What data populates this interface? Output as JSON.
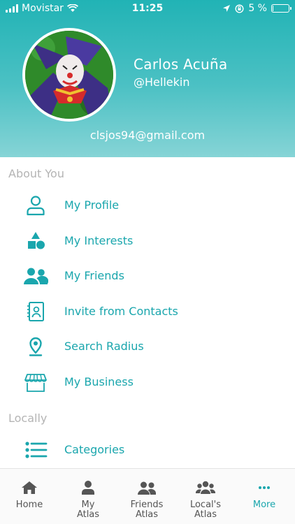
{
  "status_bar": {
    "carrier": "Movistar",
    "time": "11:25",
    "battery_text": "5 %",
    "battery_level": 0.05
  },
  "profile": {
    "name": "Carlos Acuña",
    "handle": "@Hellekin",
    "email": "clsjos94@gmail.com"
  },
  "sections": {
    "about": "About You",
    "locally": "Locally"
  },
  "menu": {
    "my_profile": "My Profile",
    "my_interests": "My Interests",
    "my_friends": "My Friends",
    "invite_contacts": "Invite from Contacts",
    "search_radius": "Search Radius",
    "my_business": "My Business",
    "categories": "Categories"
  },
  "tabs": [
    {
      "label": "Home",
      "icon": "home-icon"
    },
    {
      "label": "My\nAtlas",
      "icon": "person-icon"
    },
    {
      "label": "Friends\nAtlas",
      "icon": "friends-icon"
    },
    {
      "label": "Local's\nAtlas",
      "icon": "group-icon"
    },
    {
      "label": "More",
      "icon": "more-icon"
    }
  ],
  "colors": {
    "accent": "#1aa6ad",
    "header_top": "#21b3b5",
    "header_bottom": "#86d4d6",
    "section_title": "#b4b4b4"
  }
}
